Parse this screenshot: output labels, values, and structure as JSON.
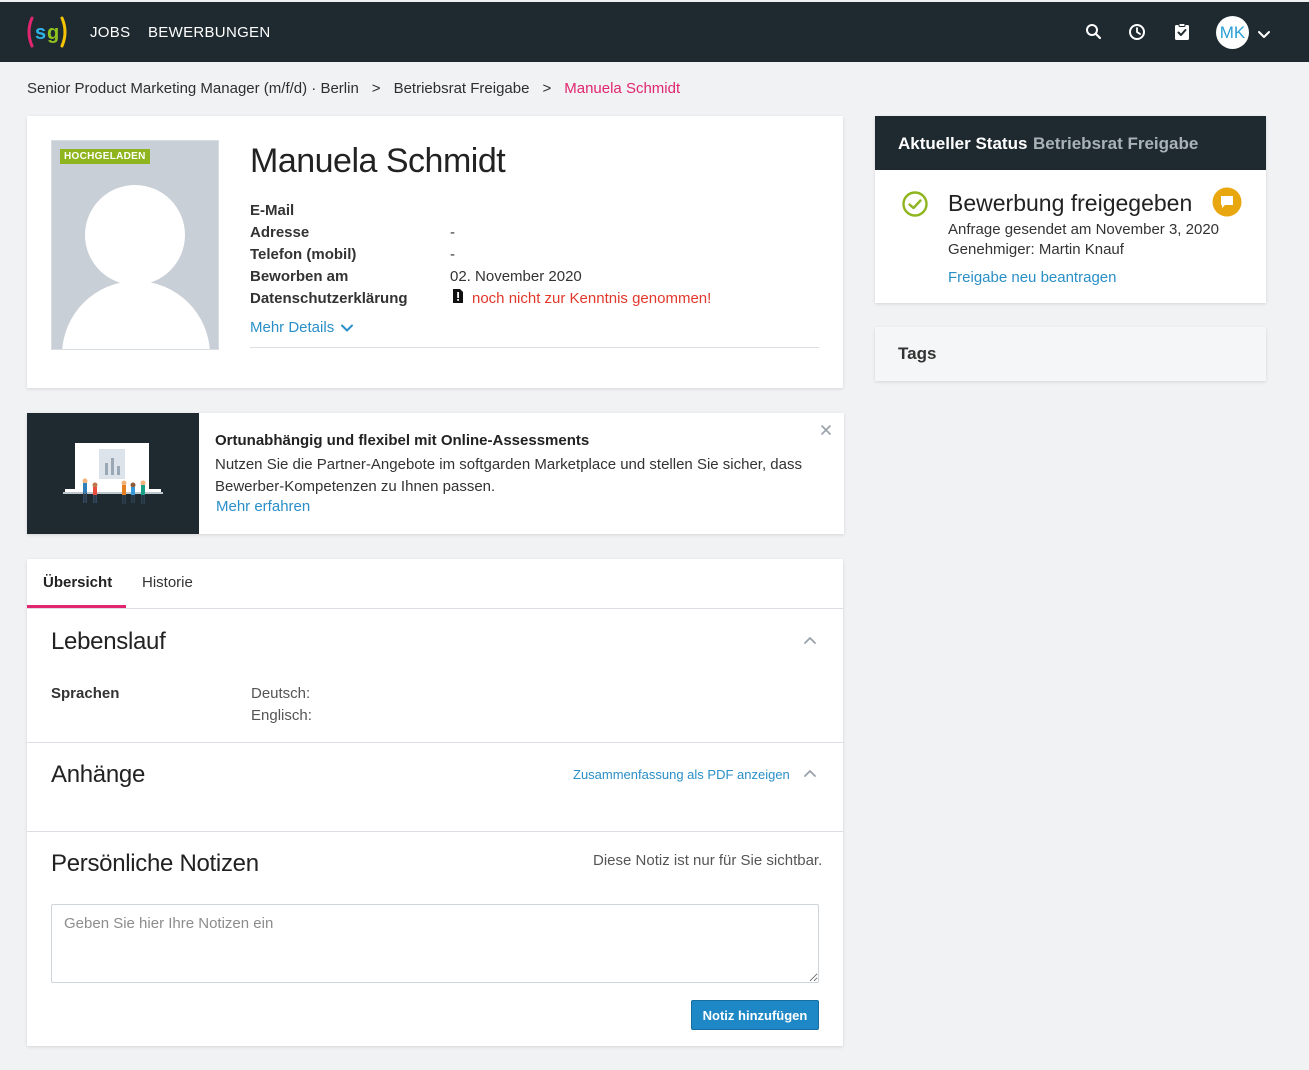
{
  "nav": {
    "logo_text": "sg",
    "jobs": "JOBS",
    "applications": "BEWERBUNGEN",
    "user_initials": "MK",
    "icons": [
      "search-icon",
      "clock-icon",
      "clipboard-check-icon",
      "chevron-down-icon"
    ]
  },
  "breadcrumb": {
    "job": "Senior Product Marketing Manager (m/f/d) · Berlin",
    "sep1": ">",
    "stage": "Betriebsrat Freigabe",
    "sep2": ">",
    "candidate": "Manuela Schmidt"
  },
  "profile": {
    "photo_badge": "HOCHGELADEN",
    "name": "Manuela Schmidt",
    "fields": [
      {
        "label": "E-Mail",
        "value": ""
      },
      {
        "label": "Adresse",
        "value": "-"
      },
      {
        "label": "Telefon (mobil)",
        "value": "-"
      },
      {
        "label": "Beworben am",
        "value": "02. November 2020"
      },
      {
        "label": "Datenschutzerklärung",
        "value": "noch nicht zur Kenntnis genommen!"
      }
    ],
    "more_details": "Mehr Details"
  },
  "promo": {
    "title": "Ortunabhängig und flexibel mit Online-Assessments",
    "text": "Nutzen Sie die Partner-Angebote im softgarden Marketplace und stellen Sie sicher, dass Bewerber-Kompetenzen zu Ihnen passen.",
    "link": "Mehr erfahren"
  },
  "tabs": [
    {
      "label": "Übersicht",
      "active": true
    },
    {
      "label": "Historie",
      "active": false
    }
  ],
  "cv": {
    "title": "Lebenslauf",
    "languages_label": "Sprachen",
    "languages": [
      "Deutsch:",
      "Englisch:"
    ]
  },
  "attachments": {
    "title": "Anhänge",
    "pdf_link": "Zusammenfassung als PDF anzeigen"
  },
  "notes": {
    "title": "Persönliche Notizen",
    "hint": "Diese Notiz ist nur für Sie sichtbar.",
    "placeholder": "Geben Sie hier Ihre Notizen ein",
    "value": "",
    "button": "Notiz hinzufügen"
  },
  "status": {
    "label": "Aktueller Status",
    "stage": "Betriebsrat Freigabe",
    "title": "Bewerbung freigegeben",
    "sent": "Anfrage gesendet am November 3, 2020",
    "approver": "Genehmiger: Martin Knauf",
    "link": "Freigabe neu beantragen"
  },
  "tags": {
    "title": "Tags"
  },
  "colors": {
    "nav_bg": "#1f2a30",
    "accent_pink": "#e0266f",
    "link_blue": "#2a8fc7",
    "success_green": "#8fb51e",
    "warning_red": "#e2382b",
    "comment_yellow": "#e8a70f"
  }
}
